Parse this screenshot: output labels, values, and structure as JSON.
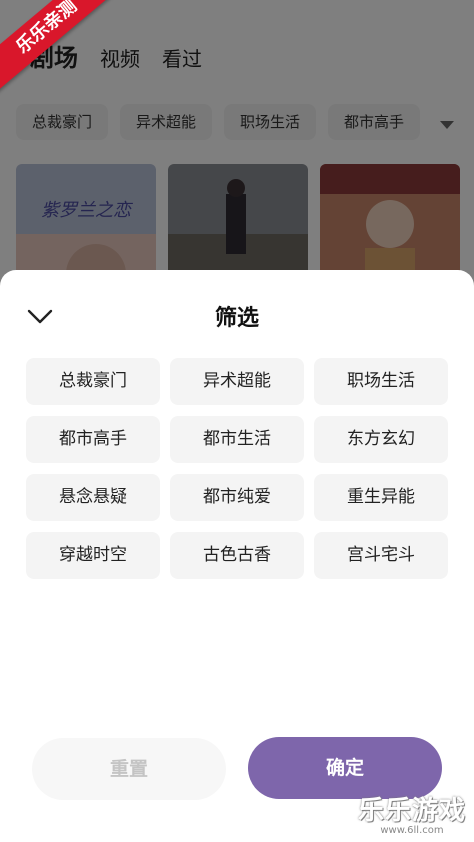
{
  "background": {
    "top_tabs": [
      "剧场",
      "视频",
      "看过"
    ],
    "category_chips": [
      "总裁豪门",
      "异术超能",
      "职场生活",
      "都市高手"
    ],
    "poster1_title": "紫罗兰之恋"
  },
  "ribbon_text": "乐乐亲测",
  "sheet": {
    "title": "筛选",
    "tags": [
      "总裁豪门",
      "异术超能",
      "职场生活",
      "都市高手",
      "都市生活",
      "东方玄幻",
      "悬念悬疑",
      "都市纯爱",
      "重生异能",
      "穿越时空",
      "古色古香",
      "宫斗宅斗"
    ],
    "reset_label": "重置",
    "confirm_label": "确定"
  },
  "watermark": {
    "brand": "乐乐游戏",
    "url": "www.6ll.com"
  },
  "colors": {
    "accent": "#7e66ab",
    "ribbon": "#d9172b"
  }
}
